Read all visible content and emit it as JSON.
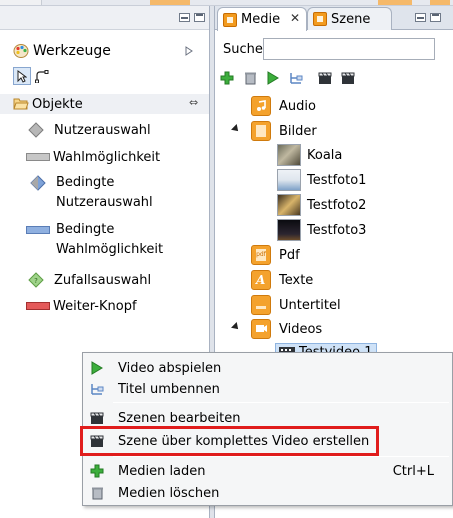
{
  "colors": {
    "accent_orange": "#f29b1f",
    "highlight_red": "#e01c1c",
    "selection_blue": "#cfe2f7"
  },
  "left_panel": {
    "palette": {
      "title": "Werkzeuge",
      "icon": "palette-icon"
    },
    "objects_title": "Objekte",
    "items": [
      {
        "label": "Nutzerauswahl",
        "icon": "gray-diamond-icon"
      },
      {
        "label": "Wahlmöglichkeit",
        "icon": "gray-bar-icon"
      },
      {
        "label_line1": "Bedingte",
        "label_line2": "Nutzerauswahl",
        "icon": "blue-diamond-icon"
      },
      {
        "label_line1": "Bedingte",
        "label_line2": "Wahlmöglichkeit",
        "icon": "blue-bar-icon"
      },
      {
        "label": "Zufallsauswahl",
        "icon": "green-diamond-icon"
      },
      {
        "label": "Weiter-Knopf",
        "icon": "red-button-icon"
      }
    ]
  },
  "right_panel": {
    "tabs": [
      {
        "label": "Medie",
        "active": true
      },
      {
        "label": "Szene",
        "active": false
      }
    ],
    "search_label": "Suche",
    "search_value": "",
    "tree": [
      {
        "label": "Audio",
        "icon": "audio-folder-icon"
      },
      {
        "label": "Bilder",
        "icon": "image-folder-icon",
        "expanded": true
      },
      {
        "label": "Koala",
        "icon": "koala-thumbnail"
      },
      {
        "label": "Testfoto1",
        "icon": "photo-thumbnail"
      },
      {
        "label": "Testfoto2",
        "icon": "photo-thumbnail"
      },
      {
        "label": "Testfoto3",
        "icon": "photo-thumbnail"
      },
      {
        "label": "Pdf",
        "icon": "pdf-icon"
      },
      {
        "label": "Texte",
        "icon": "text-icon"
      },
      {
        "label": "Untertitel",
        "icon": "subtitle-icon"
      },
      {
        "label": "Videos",
        "icon": "video-folder-icon",
        "expanded": true
      },
      {
        "label": "Testvideo 1",
        "icon": "film-icon",
        "selected": true
      }
    ]
  },
  "context_menu": {
    "items": [
      {
        "label": "Video abspielen",
        "icon": "play-icon"
      },
      {
        "label": "Titel umbennen",
        "icon": "rename-icon"
      },
      {
        "label": "Szenen bearbeiten",
        "icon": "clapper-icon"
      },
      {
        "label": "Szene über komplettes Video erstellen",
        "icon": "clapper-icon",
        "highlighted": true
      },
      {
        "label": "Medien laden",
        "icon": "add-icon",
        "shortcut": "Ctrl+L"
      },
      {
        "label": "Medien löschen",
        "icon": "trash-icon"
      }
    ]
  }
}
